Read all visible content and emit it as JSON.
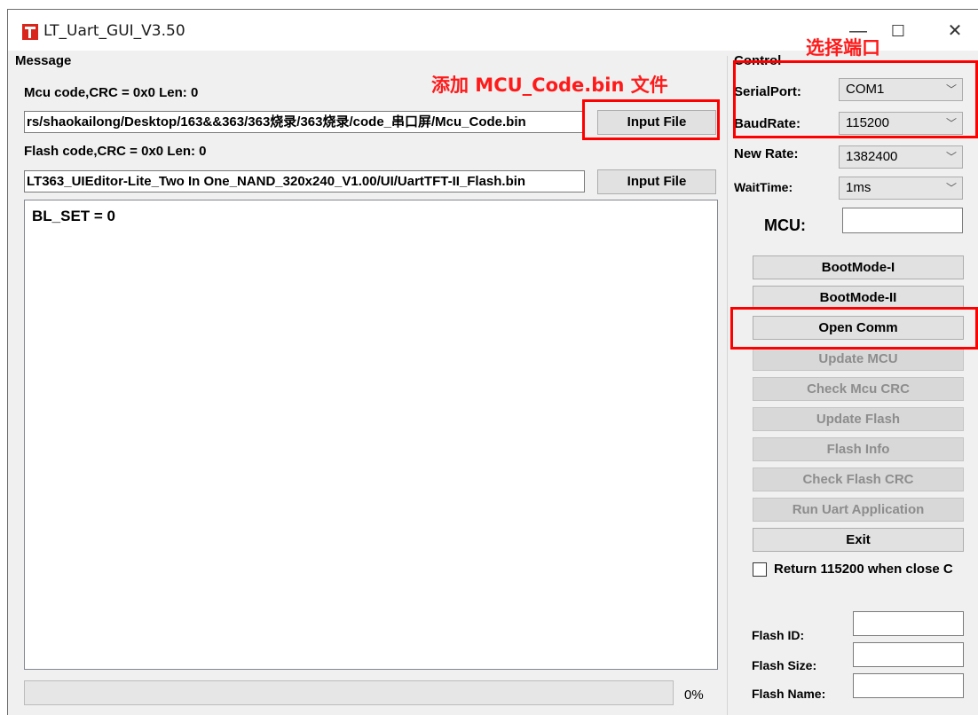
{
  "window": {
    "title": "LT_Uart_GUI_V3.50",
    "minimize": "—",
    "maximize": "☐",
    "close": "✕"
  },
  "message": {
    "group_label": "Message",
    "mcu_code_info": "Mcu code,CRC = 0x0  Len: 0",
    "mcu_path": "rs/shaokailong/Desktop/163&&363/363烧录/363烧录/code_串口屏/Mcu_Code.bin",
    "mcu_input_button": "Input File",
    "flash_code_info": "Flash code,CRC = 0x0  Len: 0",
    "flash_path": "LT363_UIEditor-Lite_Two In One_NAND_320x240_V1.00/UI/UartTFT-II_Flash.bin",
    "flash_input_button": "Input File",
    "log_text": "BL_SET = 0",
    "progress_percent": "0%",
    "progress_value": 0
  },
  "control": {
    "group_label": "Control",
    "serial_port_label": "SerialPort:",
    "serial_port_value": "COM1",
    "baud_rate_label": "BaudRate:",
    "baud_rate_value": "115200",
    "new_rate_label": "New Rate:",
    "new_rate_value": "1382400",
    "wait_time_label": "WaitTime:",
    "wait_time_value": "1ms",
    "mcu_label": "MCU:",
    "mcu_value": "",
    "buttons": {
      "bootmode_1": "BootMode-I",
      "bootmode_2": "BootMode-II",
      "open_comm": "Open Comm",
      "update_mcu": "Update MCU",
      "check_mcu_crc": "Check Mcu CRC",
      "update_flash": "Update Flash",
      "flash_info": "Flash Info",
      "check_flash_crc": "Check Flash CRC",
      "run_uart_app": "Run Uart Application",
      "exit": "Exit"
    },
    "return_checkbox_label": "Return 115200 when close C",
    "return_checkbox_checked": false,
    "flash_id_label": "Flash ID:",
    "flash_size_label": "Flash Size:",
    "flash_name_label": "Flash Name:",
    "flash_id_value": "",
    "flash_size_value": "",
    "flash_name_value": ""
  },
  "annotations": {
    "add_file_note": "添加 MCU_Code.bin 文件",
    "select_port_note": "选择端口",
    "color": "#ff0000"
  }
}
